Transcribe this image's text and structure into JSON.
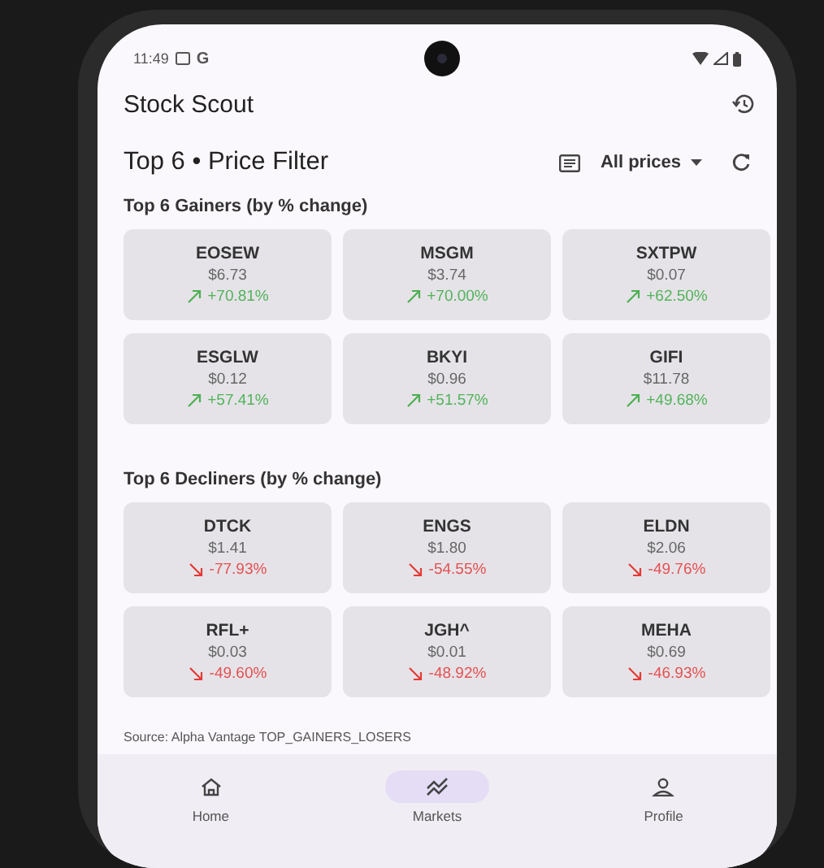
{
  "status_bar": {
    "time": "11:49",
    "carrier_glyph": "G"
  },
  "app_bar": {
    "title": "Stock Scout"
  },
  "header": {
    "title": "Top 6 • Price Filter",
    "filter": "All prices"
  },
  "sections": [
    {
      "title": "Top 6 Gainers (by % change)",
      "stocks": [
        {
          "symbol": "EOSEW",
          "price": "$6.73",
          "change": "+70.81%",
          "kind": "up"
        },
        {
          "symbol": "MSGM",
          "price": "$3.74",
          "change": "+70.00%",
          "kind": "up"
        },
        {
          "symbol": "SXTPW",
          "price": "$0.07",
          "change": "+62.50%",
          "kind": "up"
        },
        {
          "symbol": "ESGLW",
          "price": "$0.12",
          "change": "+57.41%",
          "kind": "up"
        },
        {
          "symbol": "BKYI",
          "price": "$0.96",
          "change": "+51.57%",
          "kind": "up"
        },
        {
          "symbol": "GIFI",
          "price": "$11.78",
          "change": "+49.68%",
          "kind": "up"
        }
      ]
    },
    {
      "title": "Top 6 Decliners (by % change)",
      "stocks": [
        {
          "symbol": "DTCK",
          "price": "$1.41",
          "change": "-77.93%",
          "kind": "down"
        },
        {
          "symbol": "ENGS",
          "price": "$1.80",
          "change": "-54.55%",
          "kind": "down"
        },
        {
          "symbol": "ELDN",
          "price": "$2.06",
          "change": "-49.76%",
          "kind": "down"
        },
        {
          "symbol": "RFL+",
          "price": "$0.03",
          "change": "-49.60%",
          "kind": "down"
        },
        {
          "symbol": "JGH^",
          "price": "$0.01",
          "change": "-48.92%",
          "kind": "down"
        },
        {
          "symbol": "MEHA",
          "price": "$0.69",
          "change": "-46.93%",
          "kind": "down"
        }
      ]
    }
  ],
  "source": "Source: Alpha Vantage TOP_GAINERS_LOSERS",
  "nav": [
    {
      "label": "Home",
      "selected": false
    },
    {
      "label": "Markets",
      "selected": true
    },
    {
      "label": "Profile",
      "selected": false
    }
  ]
}
